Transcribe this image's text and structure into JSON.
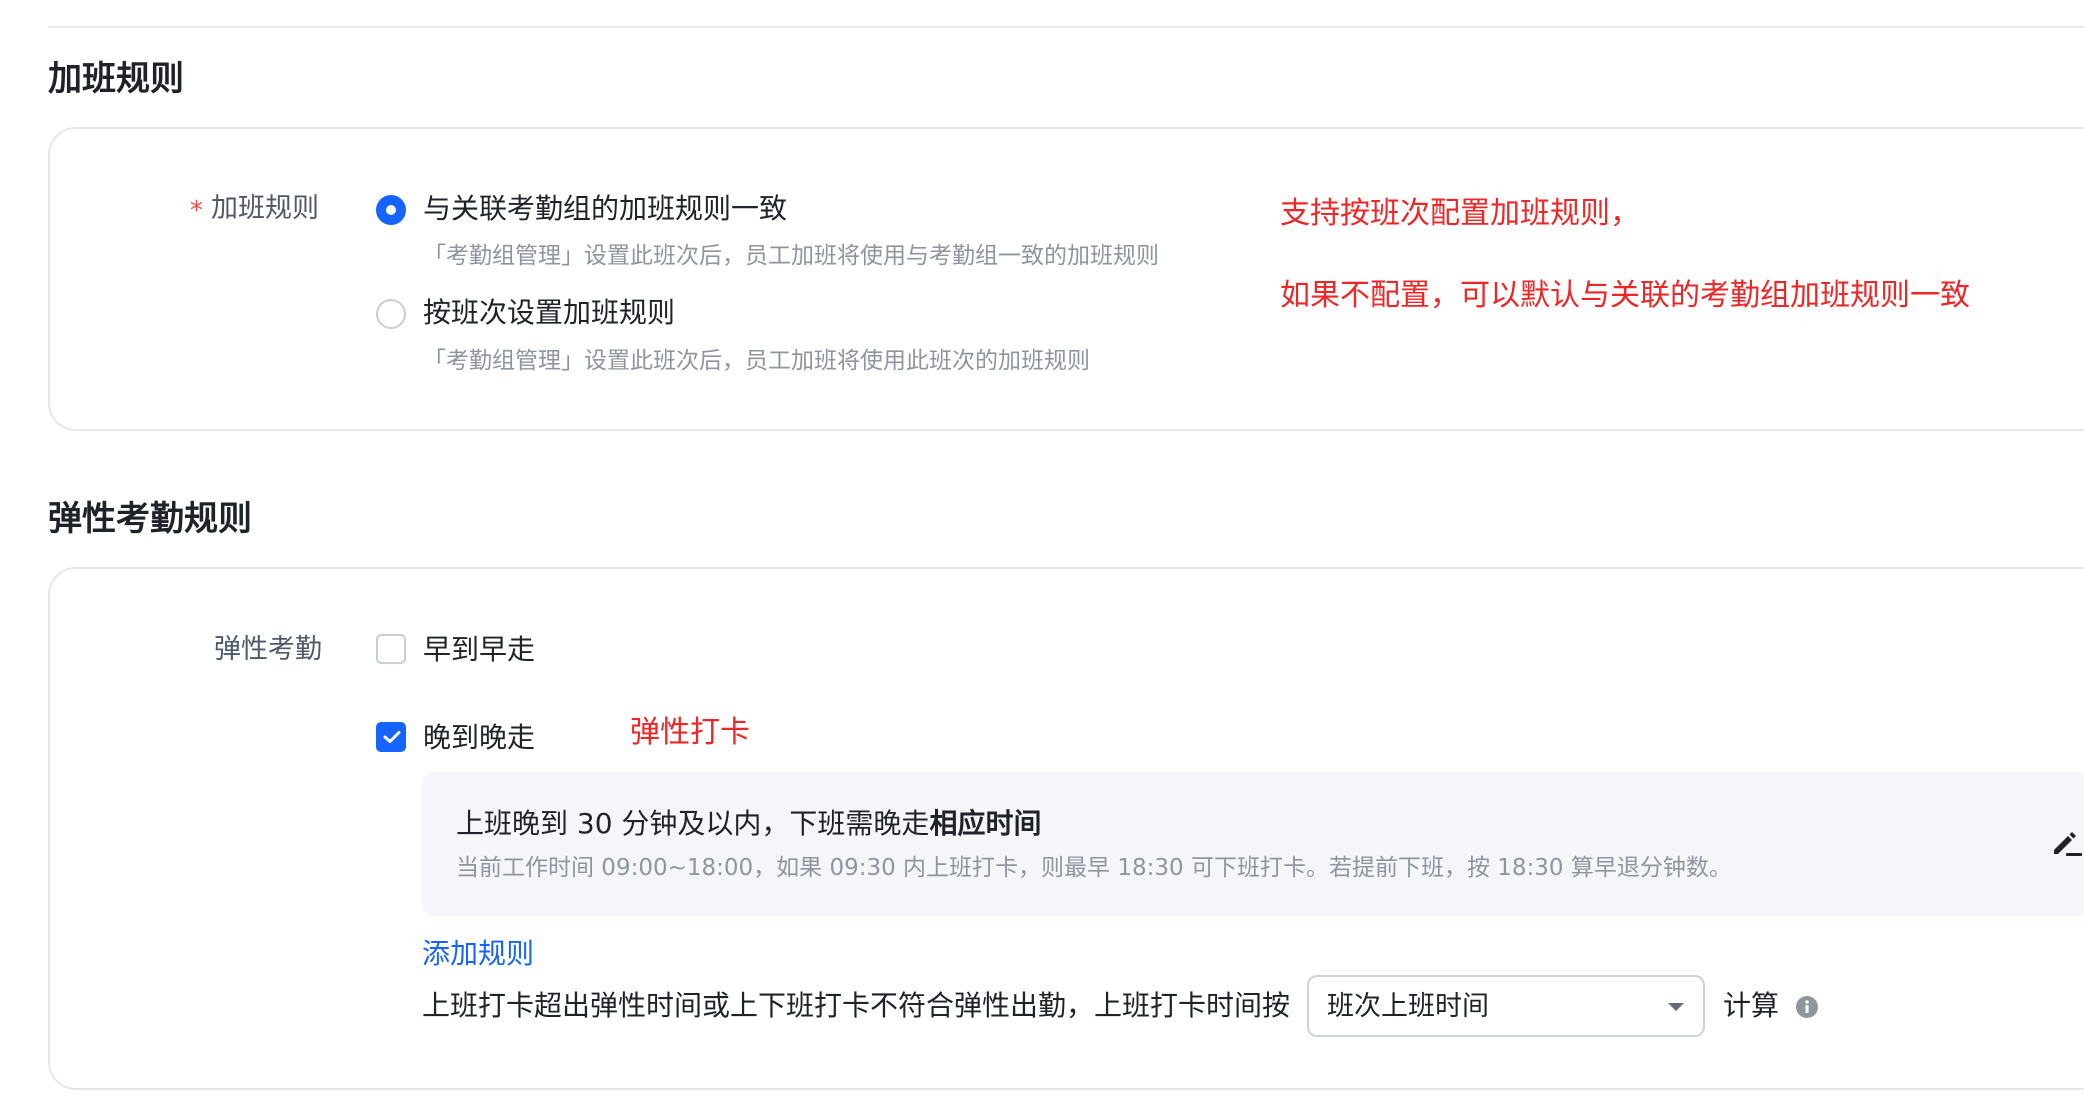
{
  "overtime_section": {
    "title": "加班规则",
    "field_label": "加班规则",
    "options": [
      {
        "label": "与关联考勤组的加班规则一致",
        "help": "「考勤组管理」设置此班次后，员工加班将使用与考勤组一致的加班规则",
        "checked": true
      },
      {
        "label": "按班次设置加班规则",
        "help": "「考勤组管理」设置此班次后，员工加班将使用此班次的加班规则",
        "checked": false
      }
    ],
    "annotation_line1": "支持按班次配置加班规则，",
    "annotation_line2": "如果不配置，可以默认与关联的考勤组加班规则一致"
  },
  "flex_section": {
    "title": "弹性考勤规则",
    "field_label": "弹性考勤",
    "options": [
      {
        "label": "早到早走",
        "checked": false
      },
      {
        "label": "晚到晚走",
        "checked": true
      }
    ],
    "annotation": "弹性打卡",
    "rule": {
      "title_prefix": "上班晚到 30 分钟及以内，下班需晚走",
      "title_bold": "相应时间",
      "description": "当前工作时间 09:00~18:00，如果 09:30 内上班打卡，则最早 18:30 可下班打卡。若提前下班，按 18:30 算早退分钟数。"
    },
    "add_rule_link": "添加规则",
    "calc_sentence": "上班打卡超出弹性时间或上下班打卡不符合弹性出勤，上班打卡时间按",
    "calc_select_value": "班次上班时间",
    "calc_suffix": "计算"
  },
  "colors": {
    "primary": "#1664ff",
    "annotation_red": "#ee2626",
    "required_star": "#f54a45",
    "help_text": "#8f959e"
  }
}
